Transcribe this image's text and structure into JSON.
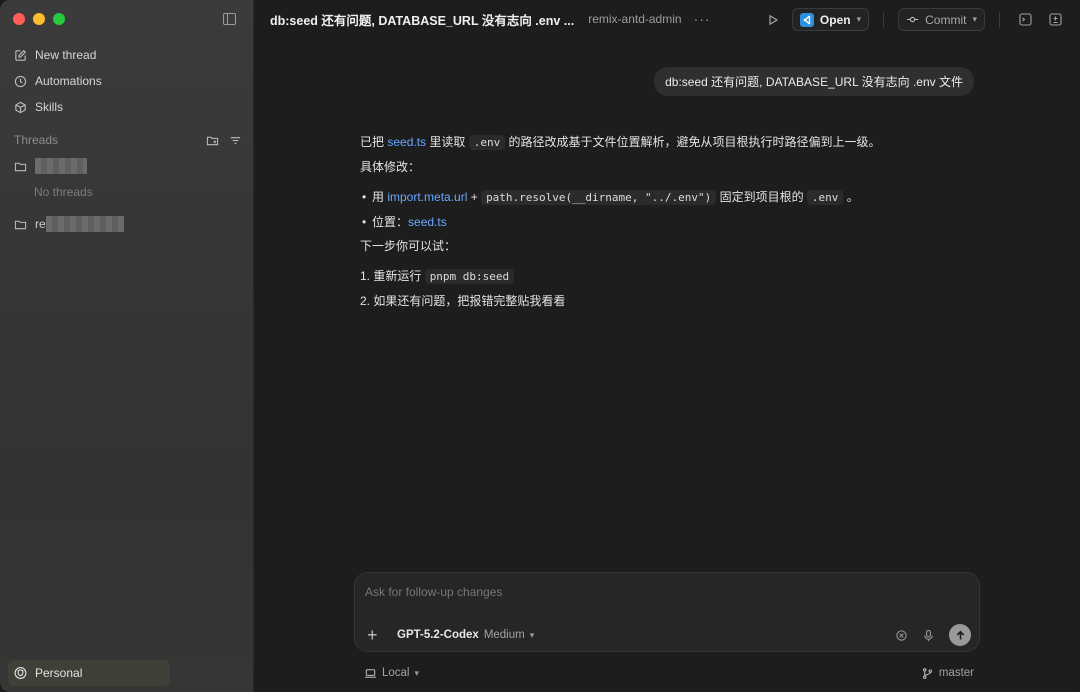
{
  "sidebar": {
    "nav": [
      {
        "label": "New thread",
        "icon": "edit-icon"
      },
      {
        "label": "Automations",
        "icon": "clock-icon"
      },
      {
        "label": "Skills",
        "icon": "cube-icon"
      }
    ],
    "threads_label": "Threads",
    "folders": [
      {
        "label": ""
      },
      {
        "label": "re"
      }
    ],
    "no_threads": "No threads",
    "account": "Personal"
  },
  "topbar": {
    "title": "db:seed 还有问题, DATABASE_URL 没有志向 .env ...",
    "repo": "remix-antd-admin",
    "more": "···",
    "open_label": "Open",
    "commit_label": "Commit"
  },
  "conversation": {
    "user_message": "db:seed 还有问题, DATABASE_URL 没有志向 .env 文件",
    "answer": {
      "intro_pre": "已把 ",
      "intro_link": "seed.ts",
      "intro_mid": " 里读取 ",
      "intro_code": ".env",
      "intro_post": " 的路径改成基于文件位置解析，避免从项目根执行时路径偏到上一级。",
      "changes_label": "具体修改：",
      "bullet1_pre": "用 ",
      "bullet1_link": "import.meta.url",
      "bullet1_plus": " + ",
      "bullet1_code": "path.resolve(__dirname, \"../.env\")",
      "bullet1_mid": " 固定到项目根的 ",
      "bullet1_code2": ".env",
      "bullet1_post": " 。",
      "bullet2_pre": "位置：",
      "bullet2_link": "seed.ts",
      "next_label": "下一步你可以试：",
      "step1_pre": "1. 重新运行 ",
      "step1_code": "pnpm db:seed",
      "step2": "2. 如果还有问题，把报错完整贴我看看"
    }
  },
  "composer": {
    "placeholder": "Ask for follow-up changes",
    "model": "GPT-5.2-Codex",
    "effort": "Medium"
  },
  "footer": {
    "env": "Local",
    "branch": "master"
  }
}
